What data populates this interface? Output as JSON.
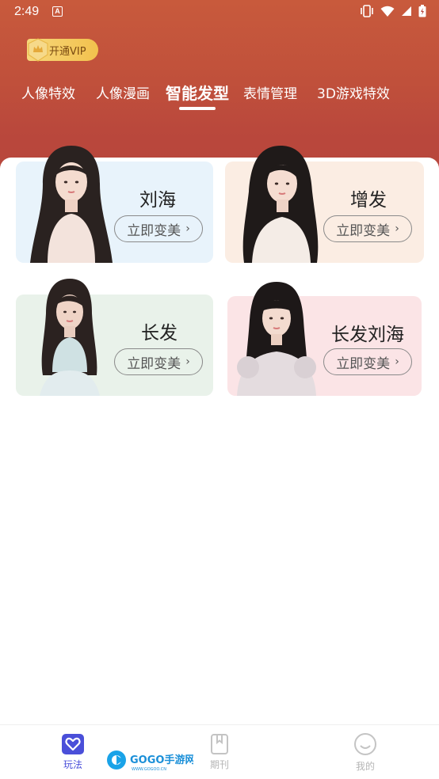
{
  "status_bar": {
    "time": "2:49",
    "notification_glyph": "A",
    "icons": [
      "vibrate-icon",
      "wifi-icon",
      "signal-icon",
      "battery-icon"
    ]
  },
  "vip": {
    "label": "开通VIP",
    "icon": "vip-crown-icon"
  },
  "tabs": [
    {
      "label": "人像特效",
      "active": false
    },
    {
      "label": "人像漫画",
      "active": false
    },
    {
      "label": "智能发型",
      "active": true
    },
    {
      "label": "表情管理",
      "active": false
    },
    {
      "label": "3D游戏特效",
      "active": false
    }
  ],
  "cards": [
    {
      "title": "刘海",
      "button": "立即变美",
      "bg": "#e8f3fb"
    },
    {
      "title": "增发",
      "button": "立即变美",
      "bg": "#fbede3"
    },
    {
      "title": "长发",
      "button": "立即变美",
      "bg": "#e9f2ea"
    },
    {
      "title": "长发刘海",
      "button": "立即变美",
      "bg": "#fbe4e6"
    }
  ],
  "bottom_nav": [
    {
      "label": "玩法",
      "icon": "heart-icon",
      "active": true
    },
    {
      "label": "期刊",
      "icon": "bookmark-icon",
      "active": false
    },
    {
      "label": "我的",
      "icon": "smile-icon",
      "active": false
    }
  ],
  "watermark": {
    "text": "GOGO手游网",
    "sub": "WWW.GOGOO.CN"
  },
  "colors": {
    "header_gradient_top": "#c85a3c",
    "header_gradient_bottom": "#b8473d",
    "accent": "#4a4fd9",
    "vip_gold": "#f2c14d"
  }
}
